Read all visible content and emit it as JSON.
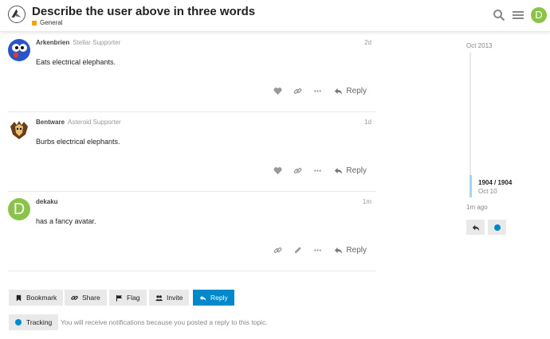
{
  "topic": {
    "title": "Describe the user above in three words",
    "category": "General",
    "category_color": "#f0a30a"
  },
  "header": {
    "user_initial": "D",
    "avatar_color": "#8bc34a"
  },
  "posts": [
    {
      "username": "Arkenbrien",
      "flair": "Stellar Supporter",
      "age": "2d",
      "body": "Eats electrical elephants.",
      "reply_label": "Reply"
    },
    {
      "username": "Bentware",
      "flair": "Asteroid Supporter",
      "age": "1d",
      "body": "Burbs electrical elephants.",
      "reply_label": "Reply"
    },
    {
      "username": "dekaku",
      "flair": "",
      "age": "1m",
      "body": "has a fancy avatar.",
      "reply_label": "Reply",
      "avatar_initial": "D"
    }
  ],
  "timeline": {
    "start": "Oct 2013",
    "position": "1904 / 1904",
    "date": "Oct 10",
    "end": "1m ago"
  },
  "footer": {
    "bookmark": "Bookmark",
    "share": "Share",
    "flag": "Flag",
    "invite": "Invite",
    "reply": "Reply",
    "tracking": "Tracking",
    "tracking_note": "You will receive notifications because you posted a reply to this topic."
  },
  "colors": {
    "primary": "#0088cc",
    "secondary_bg": "#e9e9e9"
  }
}
